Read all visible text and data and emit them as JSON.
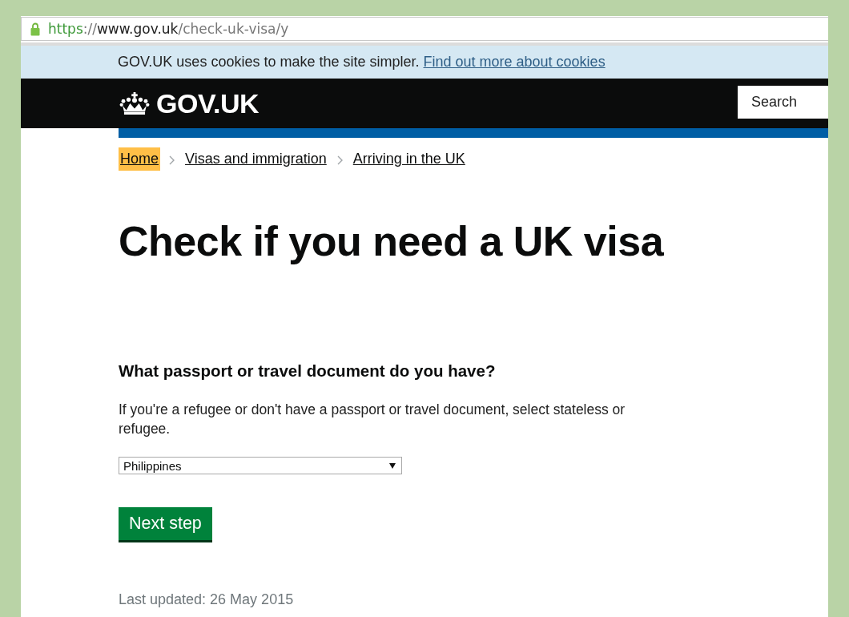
{
  "address_bar": {
    "url_parts": [
      {
        "text": "https",
        "kind": "scheme"
      },
      {
        "text": "://",
        "kind": "dim"
      },
      {
        "text": "www.gov.uk",
        "kind": "host"
      },
      {
        "text": "/check-uk-visa/y",
        "kind": "dim"
      }
    ]
  },
  "cookie_banner": {
    "text": "GOV.UK uses cookies to make the site simpler.",
    "link": "Find out more about cookies"
  },
  "header": {
    "logo": "GOV.UK",
    "search": {
      "placeholder": "Search"
    }
  },
  "breadcrumbs": [
    {
      "label": "Home",
      "focused": true
    },
    {
      "label": "Visas and immigration",
      "focused": false
    },
    {
      "label": "Arriving in the UK",
      "focused": false
    }
  ],
  "title": "Check if you need a UK visa",
  "question": {
    "label": "What passport or travel document do you have?",
    "hint": "If you're a refugee or don't have a passport or travel document, select stateless or refugee.",
    "select": {
      "value": "Philippines"
    }
  },
  "button": "Next step",
  "last_updated": "Last updated: 26 May 2015"
}
